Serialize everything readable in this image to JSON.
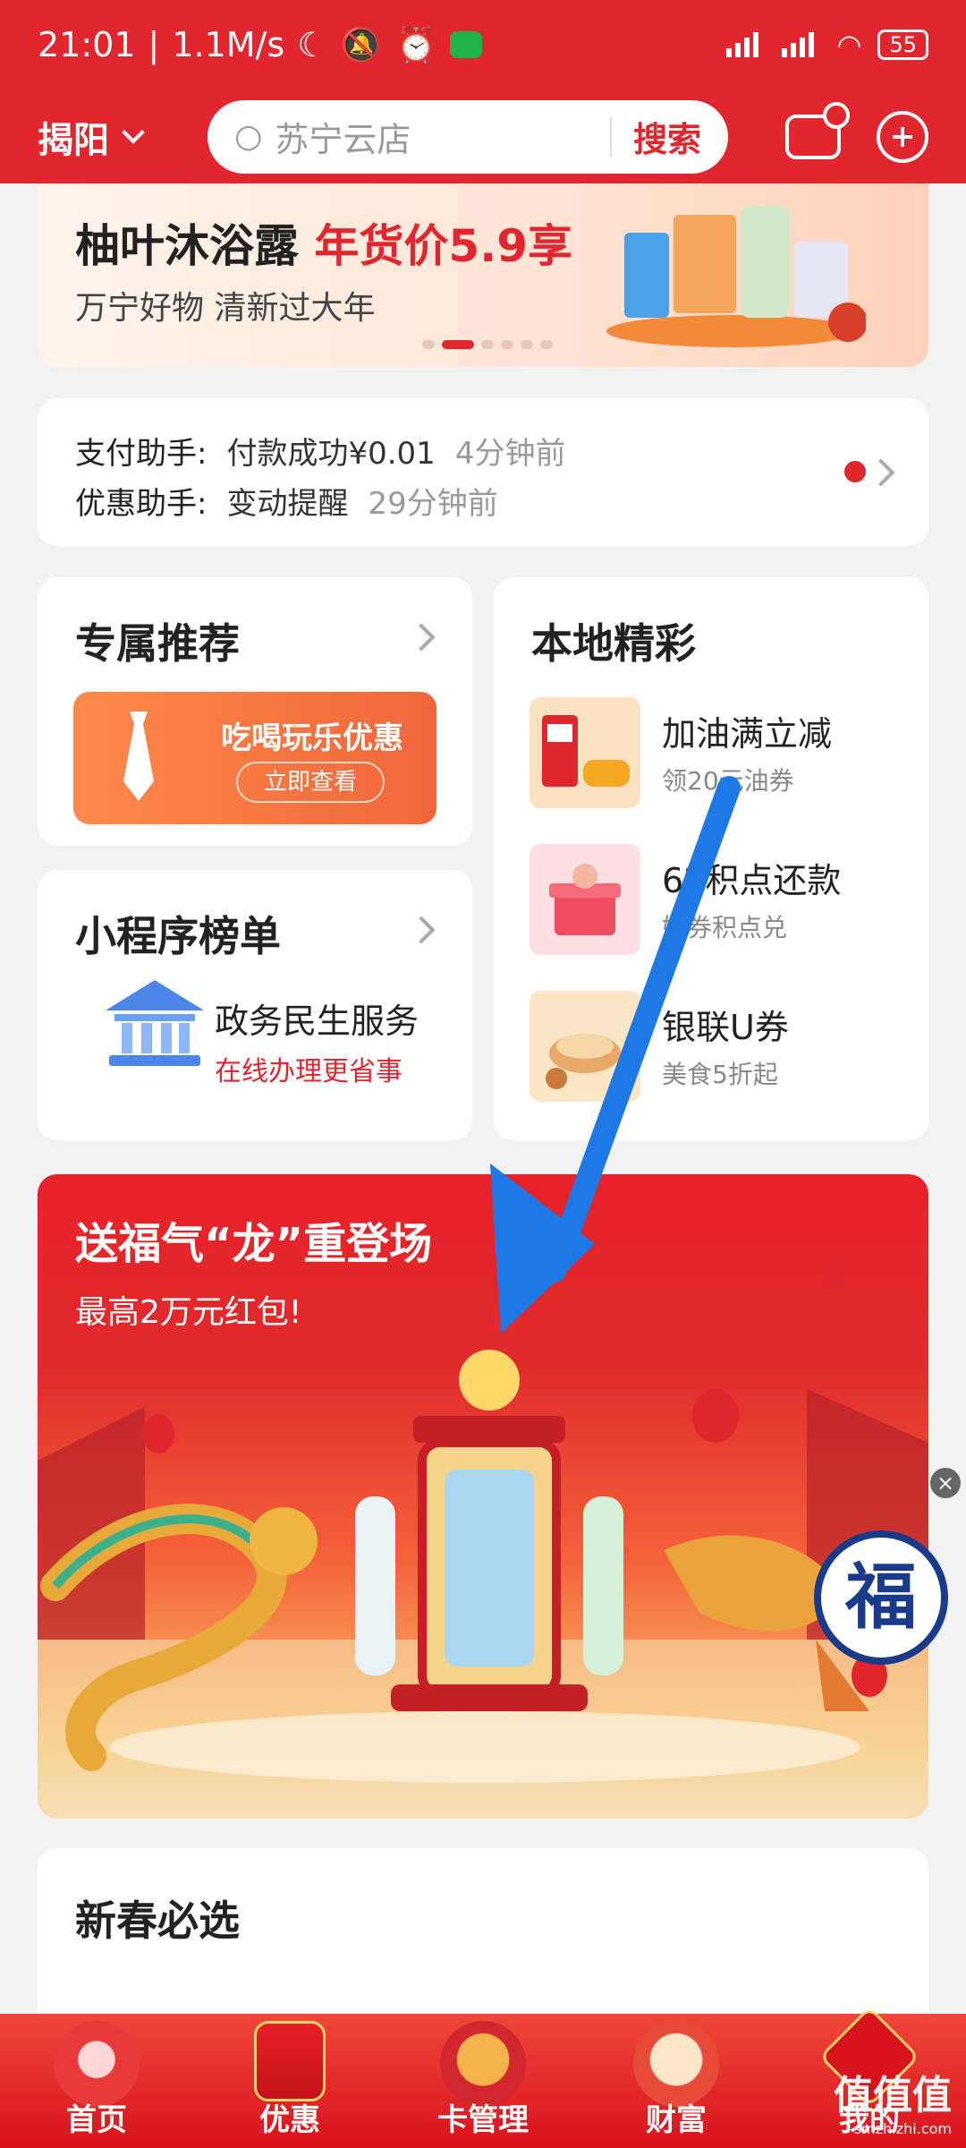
{
  "status_bar": {
    "time": "21:01",
    "speed": "1.1M/s",
    "battery": "55"
  },
  "header": {
    "city": "揭阳",
    "search_placeholder": "苏宁云店",
    "search_button": "搜索"
  },
  "top_banner": {
    "title_black": "柚叶沐浴露",
    "title_red": "年货价5.9享",
    "subtitle": "万宁好物 清新过大年"
  },
  "assistant": {
    "rows": [
      {
        "label": "支付助手:",
        "value": "付款成功¥0.01",
        "time": "4分钟前"
      },
      {
        "label": "优惠助手:",
        "value": "变动提醒",
        "time": "29分钟前"
      }
    ]
  },
  "exclusive": {
    "title": "专属推荐",
    "promo_text": "吃喝玩乐优惠",
    "promo_button": "立即查看"
  },
  "mini_programs": {
    "title": "小程序榜单",
    "item_name": "政务民生服务",
    "item_sub": "在线办理更省事"
  },
  "local": {
    "title": "本地精彩",
    "items": [
      {
        "name": "加油满立减",
        "sub": "领20元油券"
      },
      {
        "name": "62积点还款",
        "sub": "好券积点兑"
      },
      {
        "name": "银联U券",
        "sub": "美食5折起"
      }
    ]
  },
  "big_banner": {
    "title": "送福气“龙”重登场",
    "subtitle": "最高2万元红包!"
  },
  "floating": {
    "close": "×",
    "fu": "福"
  },
  "new_year": {
    "title": "新春必选"
  },
  "tabbar": {
    "tabs": [
      {
        "label": "首页"
      },
      {
        "label": "优惠"
      },
      {
        "label": "卡管理"
      },
      {
        "label": "财富"
      },
      {
        "label": "我的"
      }
    ]
  },
  "watermark": {
    "text": "值值值",
    "site": "smzhizhi.com"
  },
  "colors": {
    "brand_red": "#e0262e",
    "arrow_blue": "#1e78e6"
  }
}
